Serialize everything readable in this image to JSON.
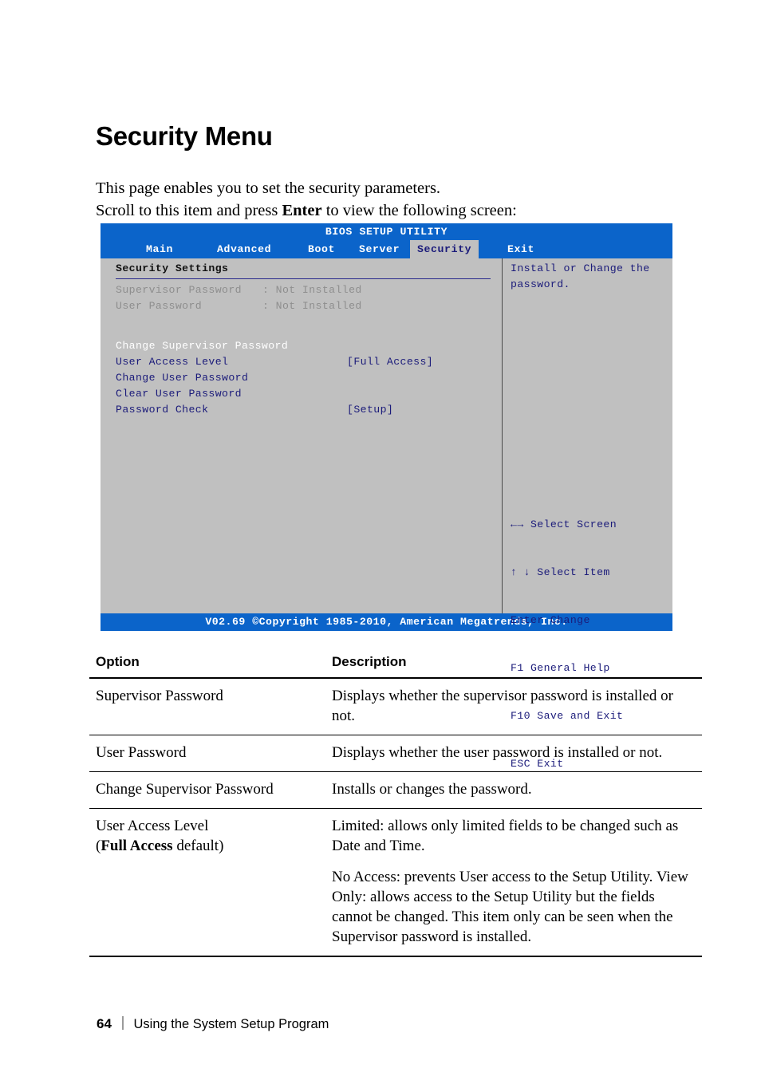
{
  "page": {
    "title": "Security Menu",
    "intro_line1": "This page enables you to set the security parameters.",
    "intro_line2_prefix": "Scroll to this item and press ",
    "intro_line2_bold": "Enter",
    "intro_line2_suffix": " to view the following screen:",
    "footer_page_number": "64",
    "footer_section": "Using the System Setup Program"
  },
  "bios": {
    "title": "BIOS SETUP UTILITY",
    "tabs": [
      {
        "label": "Main",
        "active": false
      },
      {
        "label": "Advanced",
        "active": false
      },
      {
        "label": "Boot",
        "active": false
      },
      {
        "label": "Server",
        "active": false
      },
      {
        "label": "Security",
        "active": true
      },
      {
        "label": "Exit",
        "active": false
      }
    ],
    "section_heading": "Security Settings",
    "rows": [
      {
        "label": "Supervisor Password",
        "value": ": Not Installed",
        "style": "dim"
      },
      {
        "label": "User Password",
        "value": ": Not Installed",
        "style": "dim"
      },
      {
        "label": "Change Supervisor Password",
        "value": "",
        "style": "white"
      },
      {
        "label": "User Access Level",
        "value": "[Full Access]",
        "style": "navy"
      },
      {
        "label": "Change User Password",
        "value": "",
        "style": "navy"
      },
      {
        "label": "Clear User Password",
        "value": "",
        "style": "navy"
      },
      {
        "label": "Password Check",
        "value": "[Setup]",
        "style": "navy"
      }
    ],
    "help_text": "Install or Change the password.",
    "legend": [
      "←→ Select Screen",
      "↑ ↓ Select Item",
      "Enter Change",
      "F1 General Help",
      "F10 Save and Exit",
      "ESC Exit"
    ],
    "footer": "V02.69 ©Copyright 1985-2010, American Megatrends, Inc.",
    "colors": {
      "chrome_blue": "#0b64ca",
      "panel_gray": "#c0c0c0",
      "text_navy": "#1b1b7a",
      "text_dim": "#8e8e8e",
      "text_white": "#ffffff"
    }
  },
  "options_table": {
    "headers": [
      "Option",
      "Description"
    ],
    "rows": [
      {
        "option": "Supervisor Password",
        "option_note": "",
        "description": [
          "Displays whether the supervisor password is installed or not."
        ]
      },
      {
        "option": "User Password",
        "option_note": "",
        "description": [
          "Displays whether the user password is installed or not."
        ]
      },
      {
        "option": "Change Supervisor Password",
        "option_note": "",
        "description": [
          "Installs or changes the password."
        ]
      },
      {
        "option": "User Access Level",
        "option_note_prefix": "(",
        "option_note_bold": "Full Access",
        "option_note_suffix": " default)",
        "description": [
          "Limited: allows only limited fields to be changed such as Date and Time.",
          "No Access: prevents User access to the Setup Utility. View Only: allows access to the Setup Utility but the fields cannot be changed. This item only can be seen when the Supervisor password is installed."
        ]
      }
    ]
  }
}
